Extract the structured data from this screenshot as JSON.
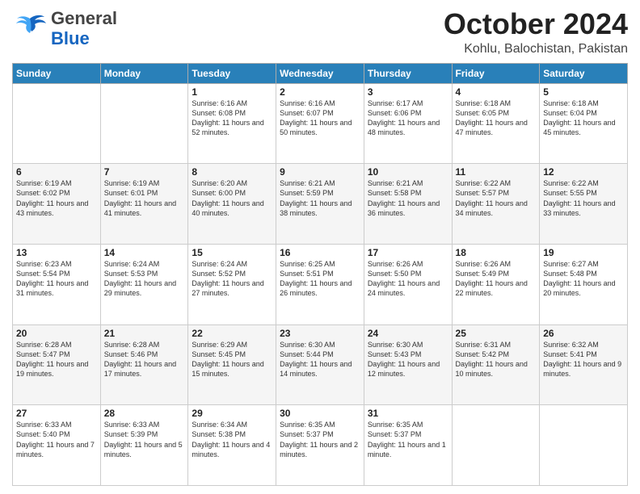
{
  "header": {
    "logo_general": "General",
    "logo_blue": "Blue",
    "month_title": "October 2024",
    "location": "Kohlu, Balochistan, Pakistan"
  },
  "weekdays": [
    "Sunday",
    "Monday",
    "Tuesday",
    "Wednesday",
    "Thursday",
    "Friday",
    "Saturday"
  ],
  "weeks": [
    [
      {
        "day": "",
        "info": ""
      },
      {
        "day": "",
        "info": ""
      },
      {
        "day": "1",
        "sunrise": "6:16 AM",
        "sunset": "6:08 PM",
        "daylight": "11 hours and 52 minutes."
      },
      {
        "day": "2",
        "sunrise": "6:16 AM",
        "sunset": "6:07 PM",
        "daylight": "11 hours and 50 minutes."
      },
      {
        "day": "3",
        "sunrise": "6:17 AM",
        "sunset": "6:06 PM",
        "daylight": "11 hours and 48 minutes."
      },
      {
        "day": "4",
        "sunrise": "6:18 AM",
        "sunset": "6:05 PM",
        "daylight": "11 hours and 47 minutes."
      },
      {
        "day": "5",
        "sunrise": "6:18 AM",
        "sunset": "6:04 PM",
        "daylight": "11 hours and 45 minutes."
      }
    ],
    [
      {
        "day": "6",
        "sunrise": "6:19 AM",
        "sunset": "6:02 PM",
        "daylight": "11 hours and 43 minutes."
      },
      {
        "day": "7",
        "sunrise": "6:19 AM",
        "sunset": "6:01 PM",
        "daylight": "11 hours and 41 minutes."
      },
      {
        "day": "8",
        "sunrise": "6:20 AM",
        "sunset": "6:00 PM",
        "daylight": "11 hours and 40 minutes."
      },
      {
        "day": "9",
        "sunrise": "6:21 AM",
        "sunset": "5:59 PM",
        "daylight": "11 hours and 38 minutes."
      },
      {
        "day": "10",
        "sunrise": "6:21 AM",
        "sunset": "5:58 PM",
        "daylight": "11 hours and 36 minutes."
      },
      {
        "day": "11",
        "sunrise": "6:22 AM",
        "sunset": "5:57 PM",
        "daylight": "11 hours and 34 minutes."
      },
      {
        "day": "12",
        "sunrise": "6:22 AM",
        "sunset": "5:55 PM",
        "daylight": "11 hours and 33 minutes."
      }
    ],
    [
      {
        "day": "13",
        "sunrise": "6:23 AM",
        "sunset": "5:54 PM",
        "daylight": "11 hours and 31 minutes."
      },
      {
        "day": "14",
        "sunrise": "6:24 AM",
        "sunset": "5:53 PM",
        "daylight": "11 hours and 29 minutes."
      },
      {
        "day": "15",
        "sunrise": "6:24 AM",
        "sunset": "5:52 PM",
        "daylight": "11 hours and 27 minutes."
      },
      {
        "day": "16",
        "sunrise": "6:25 AM",
        "sunset": "5:51 PM",
        "daylight": "11 hours and 26 minutes."
      },
      {
        "day": "17",
        "sunrise": "6:26 AM",
        "sunset": "5:50 PM",
        "daylight": "11 hours and 24 minutes."
      },
      {
        "day": "18",
        "sunrise": "6:26 AM",
        "sunset": "5:49 PM",
        "daylight": "11 hours and 22 minutes."
      },
      {
        "day": "19",
        "sunrise": "6:27 AM",
        "sunset": "5:48 PM",
        "daylight": "11 hours and 20 minutes."
      }
    ],
    [
      {
        "day": "20",
        "sunrise": "6:28 AM",
        "sunset": "5:47 PM",
        "daylight": "11 hours and 19 minutes."
      },
      {
        "day": "21",
        "sunrise": "6:28 AM",
        "sunset": "5:46 PM",
        "daylight": "11 hours and 17 minutes."
      },
      {
        "day": "22",
        "sunrise": "6:29 AM",
        "sunset": "5:45 PM",
        "daylight": "11 hours and 15 minutes."
      },
      {
        "day": "23",
        "sunrise": "6:30 AM",
        "sunset": "5:44 PM",
        "daylight": "11 hours and 14 minutes."
      },
      {
        "day": "24",
        "sunrise": "6:30 AM",
        "sunset": "5:43 PM",
        "daylight": "11 hours and 12 minutes."
      },
      {
        "day": "25",
        "sunrise": "6:31 AM",
        "sunset": "5:42 PM",
        "daylight": "11 hours and 10 minutes."
      },
      {
        "day": "26",
        "sunrise": "6:32 AM",
        "sunset": "5:41 PM",
        "daylight": "11 hours and 9 minutes."
      }
    ],
    [
      {
        "day": "27",
        "sunrise": "6:33 AM",
        "sunset": "5:40 PM",
        "daylight": "11 hours and 7 minutes."
      },
      {
        "day": "28",
        "sunrise": "6:33 AM",
        "sunset": "5:39 PM",
        "daylight": "11 hours and 5 minutes."
      },
      {
        "day": "29",
        "sunrise": "6:34 AM",
        "sunset": "5:38 PM",
        "daylight": "11 hours and 4 minutes."
      },
      {
        "day": "30",
        "sunrise": "6:35 AM",
        "sunset": "5:37 PM",
        "daylight": "11 hours and 2 minutes."
      },
      {
        "day": "31",
        "sunrise": "6:35 AM",
        "sunset": "5:37 PM",
        "daylight": "11 hours and 1 minute."
      },
      {
        "day": "",
        "info": ""
      },
      {
        "day": "",
        "info": ""
      }
    ]
  ]
}
